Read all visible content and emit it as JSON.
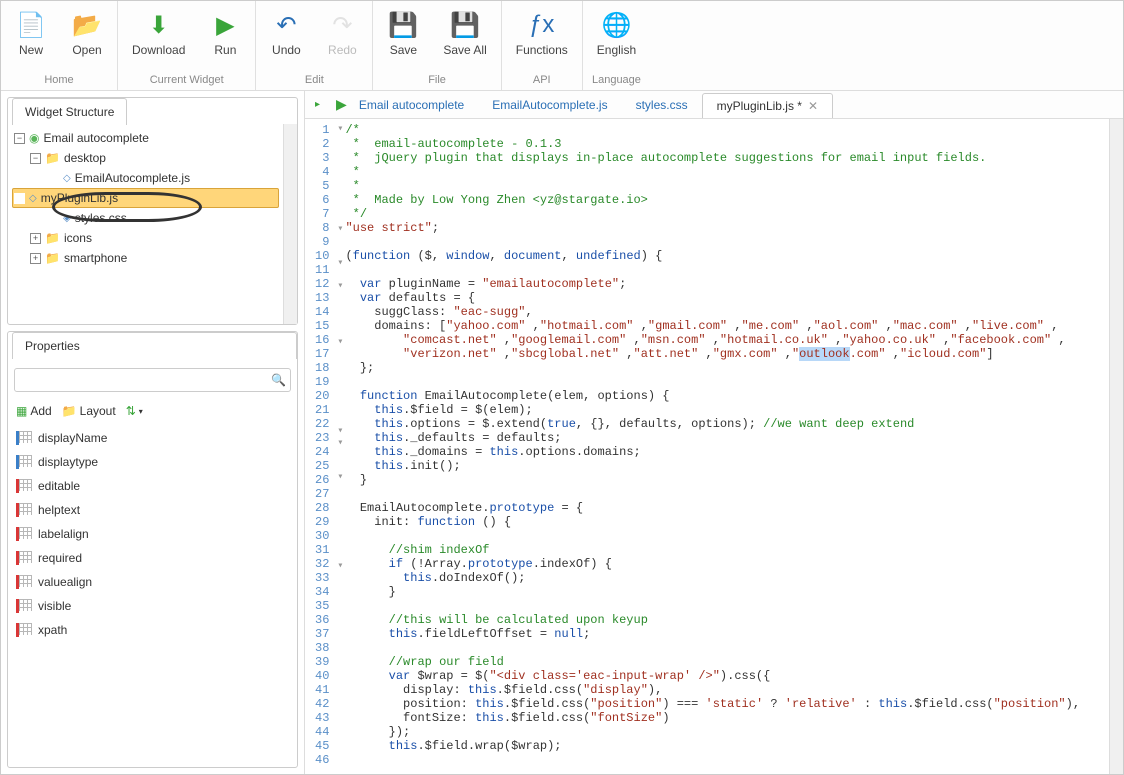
{
  "toolbar": {
    "groups": [
      {
        "label": "Home",
        "buttons": [
          {
            "id": "new",
            "label": "New",
            "icon": "📄",
            "color": "#fff"
          },
          {
            "id": "open",
            "label": "Open",
            "icon": "📂",
            "color": "#e6b84d"
          }
        ]
      },
      {
        "label": "Current Widget",
        "buttons": [
          {
            "id": "download",
            "label": "Download",
            "icon": "⬇",
            "color": "#3aa53a"
          },
          {
            "id": "run",
            "label": "Run",
            "icon": "▶",
            "color": "#3aa53a"
          }
        ]
      },
      {
        "label": "Edit",
        "buttons": [
          {
            "id": "undo",
            "label": "Undo",
            "icon": "↶",
            "color": "#2a6fb5"
          },
          {
            "id": "redo",
            "label": "Redo",
            "icon": "↷",
            "color": "#bbb",
            "disabled": true
          }
        ]
      },
      {
        "label": "File",
        "buttons": [
          {
            "id": "save",
            "label": "Save",
            "icon": "💾",
            "color": "#6a6ab5"
          },
          {
            "id": "saveall",
            "label": "Save All",
            "icon": "💾",
            "color": "#6a6ab5"
          }
        ]
      },
      {
        "label": "API",
        "buttons": [
          {
            "id": "functions",
            "label": "Functions",
            "icon": "ƒx",
            "color": "#2a6fb5"
          }
        ]
      },
      {
        "label": "Language",
        "buttons": [
          {
            "id": "english",
            "label": "English",
            "icon": "🌐",
            "color": "#3aa53a"
          }
        ]
      }
    ]
  },
  "widgetStructure": {
    "title": "Widget Structure",
    "root": "Email autocomplete",
    "nodes": [
      {
        "label": "desktop",
        "type": "folder",
        "expanded": true,
        "level": 1
      },
      {
        "label": "EmailAutocomplete.js",
        "type": "js",
        "level": 2
      },
      {
        "label": "myPluginLib.js",
        "type": "js",
        "level": 2,
        "selected": true
      },
      {
        "label": "styles.css",
        "type": "css",
        "level": 2
      },
      {
        "label": "icons",
        "type": "folder",
        "expanded": false,
        "level": 1
      },
      {
        "label": "smartphone",
        "type": "folder",
        "expanded": false,
        "level": 1
      }
    ]
  },
  "properties": {
    "title": "Properties",
    "search_placeholder": "",
    "add_label": "Add",
    "layout_label": "Layout",
    "items": [
      {
        "name": "displayName",
        "bar": "blue"
      },
      {
        "name": "displaytype",
        "bar": "blue"
      },
      {
        "name": "editable",
        "bar": "red"
      },
      {
        "name": "helptext",
        "bar": "red"
      },
      {
        "name": "labelalign",
        "bar": "red"
      },
      {
        "name": "required",
        "bar": "red"
      },
      {
        "name": "valuealign",
        "bar": "red"
      },
      {
        "name": "visible",
        "bar": "red"
      },
      {
        "name": "xpath",
        "bar": "red"
      }
    ]
  },
  "editorTabs": [
    {
      "label": "Email autocomplete",
      "play": true
    },
    {
      "label": "EmailAutocomplete.js"
    },
    {
      "label": "styles.css"
    },
    {
      "label": "myPluginLib.js *",
      "active": true,
      "closable": true
    }
  ],
  "code": {
    "lines": [
      {
        "n": 1,
        "f": "▾",
        "html": "<span class='c-comment'>/*</span>"
      },
      {
        "n": 2,
        "f": " ",
        "html": "<span class='c-comment'> *  email-autocomplete - 0.1.3</span>"
      },
      {
        "n": 3,
        "f": " ",
        "html": "<span class='c-comment'> *  jQuery plugin that displays in-place autocomplete suggestions for email input fields.</span>"
      },
      {
        "n": 4,
        "f": " ",
        "html": "<span class='c-comment'> *</span>"
      },
      {
        "n": 5,
        "f": " ",
        "html": "<span class='c-comment'> *</span>"
      },
      {
        "n": 6,
        "f": " ",
        "html": "<span class='c-comment'> *  Made by Low Yong Zhen &lt;yz@stargate.io&gt;</span>"
      },
      {
        "n": 7,
        "f": " ",
        "html": "<span class='c-comment'> */</span>"
      },
      {
        "n": 8,
        "f": " ",
        "html": "<span class='c-string'>\"use strict\"</span>;"
      },
      {
        "n": 9,
        "f": " ",
        "html": ""
      },
      {
        "n": 10,
        "f": "▾",
        "html": "(<span class='c-keyword'>function</span> ($, <span class='c-keyword'>window</span>, <span class='c-keyword'>document</span>, <span class='c-keyword'>undefined</span>) {"
      },
      {
        "n": 11,
        "f": " ",
        "html": ""
      },
      {
        "n": 12,
        "f": " ",
        "html": "  <span class='c-keyword'>var</span> pluginName = <span class='c-string'>\"emailautocomplete\"</span>;"
      },
      {
        "n": 13,
        "f": "▾",
        "html": "  <span class='c-keyword'>var</span> defaults = {"
      },
      {
        "n": 14,
        "f": " ",
        "html": "    suggClass: <span class='c-string'>\"eac-sugg\"</span>,"
      },
      {
        "n": 15,
        "f": "▾",
        "html": "    domains: [<span class='c-string'>\"yahoo.com\"</span> ,<span class='c-string'>\"hotmail.com\"</span> ,<span class='c-string'>\"gmail.com\"</span> ,<span class='c-string'>\"me.com\"</span> ,<span class='c-string'>\"aol.com\"</span> ,<span class='c-string'>\"mac.com\"</span> ,<span class='c-string'>\"live.com\"</span> ,"
      },
      {
        "n": 16,
        "f": " ",
        "html": "        <span class='c-string'>\"comcast.net\"</span> ,<span class='c-string'>\"googlemail.com\"</span> ,<span class='c-string'>\"msn.com\"</span> ,<span class='c-string'>\"hotmail.co.uk\"</span> ,<span class='c-string'>\"yahoo.co.uk\"</span> ,<span class='c-string'>\"facebook.com\"</span> ,"
      },
      {
        "n": 17,
        "f": " ",
        "html": "        <span class='c-string'>\"verizon.net\"</span> ,<span class='c-string'>\"sbcglobal.net\"</span> ,<span class='c-string'>\"att.net\"</span> ,<span class='c-string'>\"gmx.com\"</span> ,<span class='c-string'>\"<span class='highlight-sel'>outlook</span>.com\"</span> ,<span class='c-string'>\"icloud.com\"</span>]"
      },
      {
        "n": 18,
        "f": " ",
        "html": "  };"
      },
      {
        "n": 19,
        "f": " ",
        "html": ""
      },
      {
        "n": 20,
        "f": "▾",
        "html": "  <span class='c-keyword'>function</span> EmailAutocomplete(elem, options) {"
      },
      {
        "n": 21,
        "f": " ",
        "html": "    <span class='c-keyword'>this</span>.$field = $(elem);"
      },
      {
        "n": 22,
        "f": " ",
        "html": "    <span class='c-keyword'>this</span>.options = $.extend(<span class='c-keyword'>true</span>, {}, defaults, options); <span class='c-comment'>//we want deep extend</span>"
      },
      {
        "n": 23,
        "f": " ",
        "html": "    <span class='c-keyword'>this</span>._defaults = defaults;"
      },
      {
        "n": 24,
        "f": " ",
        "html": "    <span class='c-keyword'>this</span>._domains = <span class='c-keyword'>this</span>.options.domains;"
      },
      {
        "n": 25,
        "f": " ",
        "html": "    <span class='c-keyword'>this</span>.init();"
      },
      {
        "n": 26,
        "f": " ",
        "html": "  }"
      },
      {
        "n": 27,
        "f": " ",
        "html": ""
      },
      {
        "n": 28,
        "f": "▾",
        "html": "  EmailAutocomplete.<span class='c-prop'>prototype</span> = {"
      },
      {
        "n": 29,
        "f": "▾",
        "html": "    init: <span class='c-keyword'>function</span> () {"
      },
      {
        "n": 30,
        "f": " ",
        "html": ""
      },
      {
        "n": 31,
        "f": " ",
        "html": "      <span class='c-comment'>//shim indexOf</span>"
      },
      {
        "n": 32,
        "f": "▾",
        "html": "      <span class='c-keyword'>if</span> (!Array.<span class='c-prop'>prototype</span>.indexOf) {"
      },
      {
        "n": 33,
        "f": " ",
        "html": "        <span class='c-keyword'>this</span>.doIndexOf();"
      },
      {
        "n": 34,
        "f": " ",
        "html": "      }"
      },
      {
        "n": 35,
        "f": " ",
        "html": ""
      },
      {
        "n": 36,
        "f": " ",
        "html": "      <span class='c-comment'>//this will be calculated upon keyup</span>"
      },
      {
        "n": 37,
        "f": " ",
        "html": "      <span class='c-keyword'>this</span>.fieldLeftOffset = <span class='c-keyword'>null</span>;"
      },
      {
        "n": 38,
        "f": " ",
        "html": ""
      },
      {
        "n": 39,
        "f": " ",
        "html": "      <span class='c-comment'>//wrap our field</span>"
      },
      {
        "n": 40,
        "f": "▾",
        "html": "      <span class='c-keyword'>var</span> $wrap = $(<span class='c-string'>\"&lt;div class='eac-input-wrap' /&gt;\"</span>).css({"
      },
      {
        "n": 41,
        "f": " ",
        "html": "        display: <span class='c-keyword'>this</span>.$field.css(<span class='c-string'>\"display\"</span>),"
      },
      {
        "n": 42,
        "f": " ",
        "html": "        position: <span class='c-keyword'>this</span>.$field.css(<span class='c-string'>\"position\"</span>) === <span class='c-string'>'static'</span> ? <span class='c-string'>'relative'</span> : <span class='c-keyword'>this</span>.$field.css(<span class='c-string'>\"position\"</span>),"
      },
      {
        "n": 43,
        "f": " ",
        "html": "        fontSize: <span class='c-keyword'>this</span>.$field.css(<span class='c-string'>\"fontSize\"</span>)"
      },
      {
        "n": 44,
        "f": " ",
        "html": "      });"
      },
      {
        "n": 45,
        "f": " ",
        "html": "      <span class='c-keyword'>this</span>.$field.wrap($wrap);"
      },
      {
        "n": 46,
        "f": " ",
        "html": ""
      }
    ]
  }
}
